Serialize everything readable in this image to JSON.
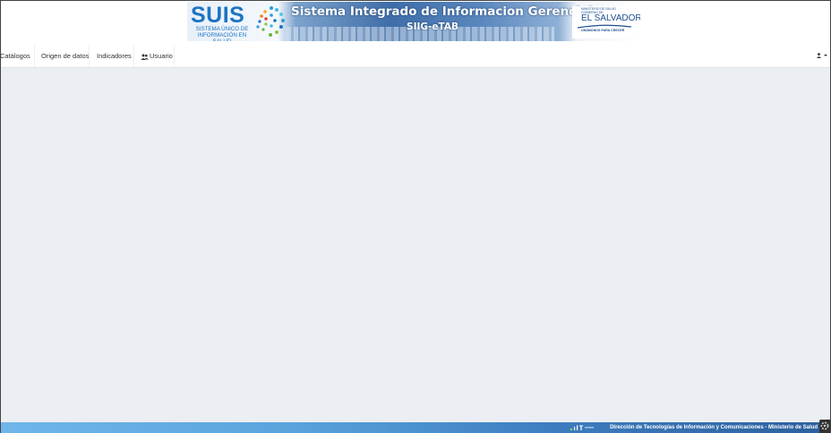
{
  "header": {
    "suis_logo_text": "SUIS",
    "suis_logo_subtitle": "SISTEMA ÚNICO DE INFORMACIÓN EN SALUD",
    "title": "Sistema Integrado de Informacion Gerencial",
    "subtitle": "SIIG-eTAB",
    "ministry_logo": {
      "line1": "MINISTERIO DE SALUD",
      "line2": "GOBIERNO DE",
      "country": "EL SALVADOR",
      "slogan": "UNÁMONOS PARA CRECER"
    }
  },
  "navbar": {
    "items": [
      {
        "label": "Catálogos"
      },
      {
        "label": "Origen de datos"
      },
      {
        "label": "Indicadores"
      },
      {
        "label": "Usuario",
        "icon": "users-icon"
      }
    ],
    "user_menu_icon": "user-icon"
  },
  "footer": {
    "text": "Dirección de Tecnologías de Información y Comunicaciones - Ministerio de Salud"
  },
  "colors": {
    "background": "#ebeef2",
    "brand_blue": "#1d74c3",
    "footer_start": "#6fb6ea",
    "footer_end": "#2c5f9c"
  }
}
